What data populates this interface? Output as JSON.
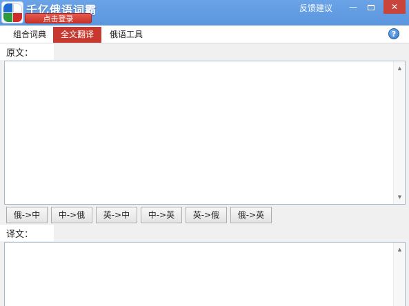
{
  "titlebar": {
    "app_title": "千亿俄语词霸",
    "login_label": "点击登录",
    "feedback_label": "反馈建议",
    "minimize_glyph": "—",
    "close_glyph": "✕"
  },
  "tabs": [
    {
      "label": "组合词典",
      "active": false
    },
    {
      "label": "全文翻译",
      "active": true
    },
    {
      "label": "俄语工具",
      "active": false
    }
  ],
  "help_glyph": "?",
  "source": {
    "label": "原文：",
    "value": ""
  },
  "target": {
    "label": "译文：",
    "value": ""
  },
  "translate_buttons": [
    {
      "label": "俄->中"
    },
    {
      "label": "中->俄"
    },
    {
      "label": "英->中"
    },
    {
      "label": "中->英"
    },
    {
      "label": "英->俄"
    },
    {
      "label": "俄->英"
    }
  ],
  "colors": {
    "titlebar": "#5b95de",
    "active_tab": "#c7392f",
    "login_button": "#d03a30"
  },
  "icons": {
    "logo": "app-logo-icon",
    "help": "help-icon",
    "scroll_up": "scroll-up-arrow-icon",
    "scroll_down": "scroll-down-arrow-icon"
  }
}
